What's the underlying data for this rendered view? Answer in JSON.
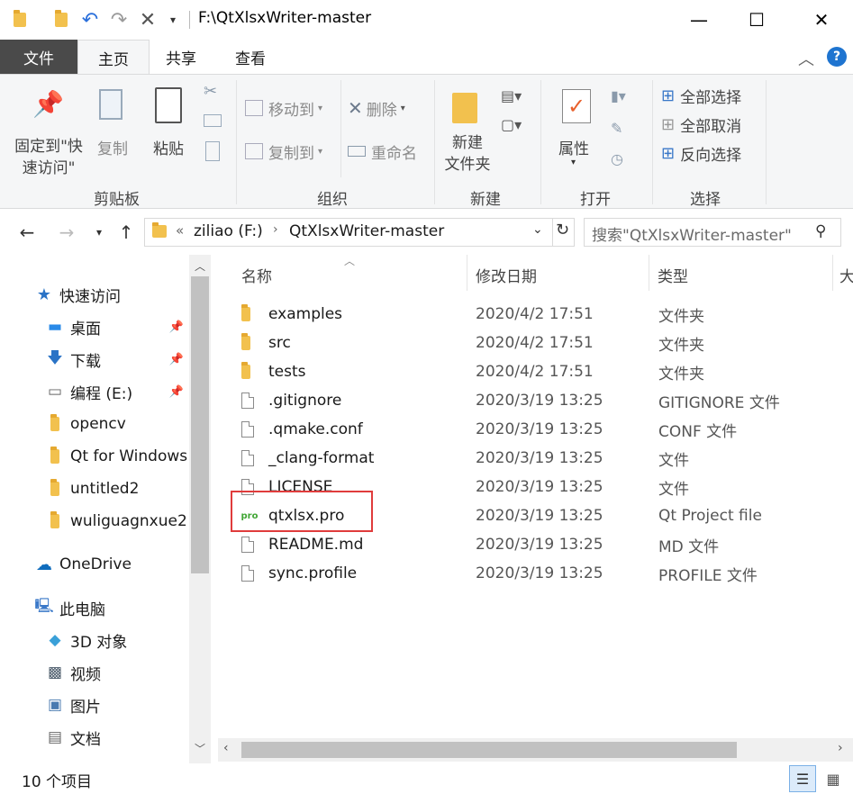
{
  "window": {
    "title": "F:\\QtXlsxWriter-master",
    "minimize_glyph": "—",
    "maximize_glyph": "☐",
    "close_glyph": "✕"
  },
  "ribbon_tabs": [
    "文件",
    "主页",
    "共享",
    "查看"
  ],
  "ribbon": {
    "clipboard": {
      "pin_label": "固定到\"快\n速访问\"",
      "copy_label": "复制",
      "paste_label": "粘贴",
      "group_name": "剪贴板"
    },
    "organize": {
      "move_to": "移动到",
      "copy_to": "复制到",
      "delete": "删除",
      "rename": "重命名",
      "group_name": "组织"
    },
    "new": {
      "new_folder": "新建\n文件夹",
      "group_name": "新建"
    },
    "open": {
      "properties": "属性",
      "group_name": "打开"
    },
    "select": {
      "select_all": "全部选择",
      "select_none": "全部取消",
      "invert": "反向选择",
      "group_name": "选择"
    }
  },
  "address": {
    "overflow": "«",
    "crumbs": [
      "ziliao (F:)",
      "QtXlsxWriter-master"
    ],
    "search_placeholder": "搜索\"QtXlsxWriter-master\""
  },
  "sidebar": {
    "quick_access": "快速访问",
    "items": [
      {
        "label": "桌面",
        "icon": "desktop-icon",
        "pinned": true
      },
      {
        "label": "下载",
        "icon": "download-icon",
        "pinned": true
      },
      {
        "label": "编程 (E:)",
        "icon": "drive-icon",
        "pinned": true
      },
      {
        "label": "opencv",
        "icon": "folder-icon",
        "pinned": false
      },
      {
        "label": "Qt for Windows",
        "icon": "folder-icon",
        "pinned": false
      },
      {
        "label": "untitled2",
        "icon": "folder-icon",
        "pinned": false
      },
      {
        "label": "wuliguagnxue2",
        "icon": "folder-icon",
        "pinned": false
      }
    ],
    "onedrive": "OneDrive",
    "this_pc": "此电脑",
    "pc_items": [
      {
        "label": "3D 对象",
        "icon": "3d-objects-icon"
      },
      {
        "label": "视频",
        "icon": "video-icon"
      },
      {
        "label": "图片",
        "icon": "pictures-icon"
      },
      {
        "label": "文档",
        "icon": "documents-icon"
      }
    ]
  },
  "columns": {
    "name": "名称",
    "date": "修改日期",
    "type": "类型",
    "size": "大"
  },
  "files": [
    {
      "name": "examples",
      "date": "2020/4/2 17:51",
      "type": "文件夹",
      "icon": "folder"
    },
    {
      "name": "src",
      "date": "2020/4/2 17:51",
      "type": "文件夹",
      "icon": "folder"
    },
    {
      "name": "tests",
      "date": "2020/4/2 17:51",
      "type": "文件夹",
      "icon": "folder"
    },
    {
      "name": ".gitignore",
      "date": "2020/3/19 13:25",
      "type": "GITIGNORE 文件",
      "icon": "file"
    },
    {
      "name": ".qmake.conf",
      "date": "2020/3/19 13:25",
      "type": "CONF 文件",
      "icon": "file"
    },
    {
      "name": "_clang-format",
      "date": "2020/3/19 13:25",
      "type": "文件",
      "icon": "file"
    },
    {
      "name": "LICENSE",
      "date": "2020/3/19 13:25",
      "type": "文件",
      "icon": "file"
    },
    {
      "name": "qtxlsx.pro",
      "date": "2020/3/19 13:25",
      "type": "Qt Project file",
      "icon": "pro"
    },
    {
      "name": "README.md",
      "date": "2020/3/19 13:25",
      "type": "MD 文件",
      "icon": "file"
    },
    {
      "name": "sync.profile",
      "date": "2020/3/19 13:25",
      "type": "PROFILE 文件",
      "icon": "file"
    }
  ],
  "highlight_color": "#e03c3c",
  "status": {
    "count": "10 个项目"
  }
}
